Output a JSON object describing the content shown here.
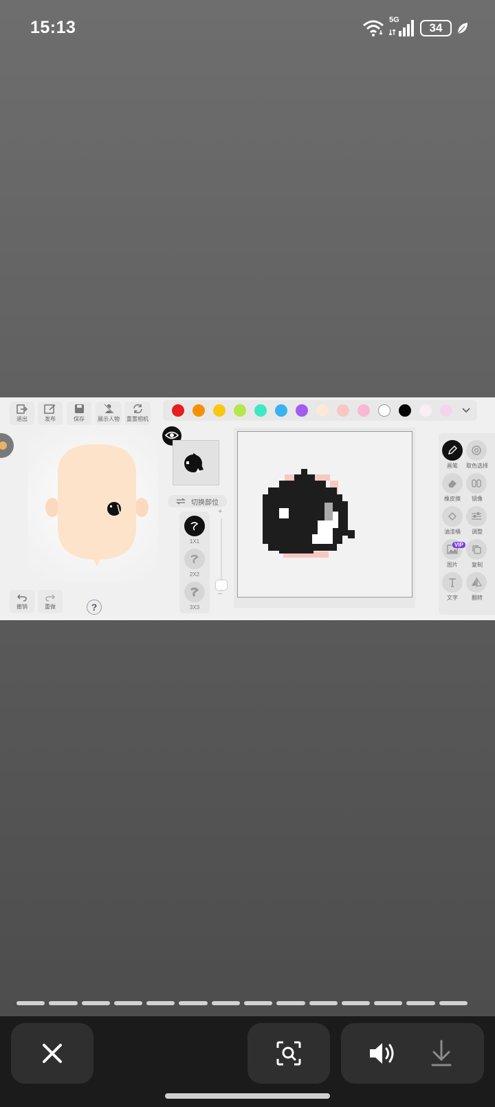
{
  "status_bar": {
    "time": "15:13",
    "network": "5G",
    "battery": "34",
    "icons": [
      "wifi-icon",
      "signal-icon",
      "battery-icon",
      "leaf-icon"
    ]
  },
  "game": {
    "toolbar": {
      "exit": "退出",
      "publish": "发布",
      "save": "保存",
      "show_character": "展示人物",
      "reset_camera": "重置相机"
    },
    "history": {
      "undo": "撤销",
      "redo": "重做"
    },
    "help": "?",
    "palette_colors": [
      "#e81d1d",
      "#f59100",
      "#f9c80e",
      "#b7e64a",
      "#3ee8c7",
      "#3ab2f2",
      "#a25cf0",
      "#fbe9d7",
      "#f8c7c2",
      "#f8b9d5",
      "#ffffff",
      "#050505",
      "#f9eef3",
      "#f6d5ec"
    ],
    "switch_part": "切换部位",
    "brushes": [
      {
        "label": "1X1",
        "selected": true
      },
      {
        "label": "2X2",
        "selected": false
      },
      {
        "label": "3X3",
        "selected": false
      }
    ],
    "slider": {
      "plus": "+",
      "minus": "−"
    },
    "tools": {
      "brush": "画笔",
      "color_picker": "取色选择",
      "eraser": "橡皮擦",
      "mirror": "镜像",
      "bucket": "油漆桶",
      "adjust": "调整",
      "image": "图片",
      "copy": "复制",
      "text": "文字",
      "flip": "翻转",
      "vip": "VIP"
    }
  },
  "progress_segments": 14,
  "bottom_actions": {
    "close": "close-icon",
    "scan": "scan-icon",
    "volume": "volume-icon",
    "download": "download-icon"
  }
}
